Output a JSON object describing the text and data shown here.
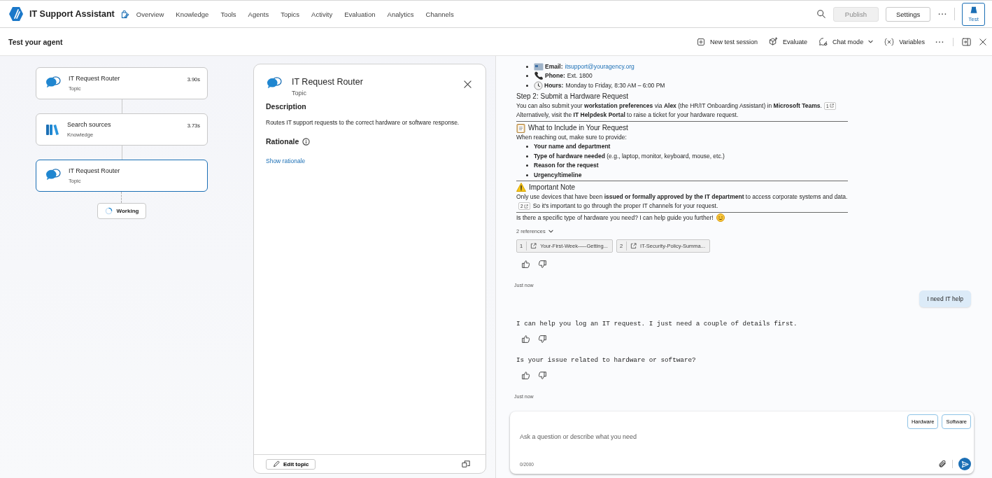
{
  "app": {
    "title": "IT Support Assistant",
    "nav": [
      "Overview",
      "Knowledge",
      "Tools",
      "Agents",
      "Topics",
      "Activity",
      "Evaluation",
      "Analytics",
      "Channels"
    ],
    "publish": {
      "label": "Publish",
      "disabled": true
    },
    "settings": {
      "label": "Settings"
    },
    "test": {
      "label": "Test",
      "selected": true
    }
  },
  "subheader": {
    "title": "Test your agent",
    "actions": [
      {
        "label": "New test session",
        "kind": "new"
      },
      {
        "label": "Evaluate",
        "kind": "evaluate"
      },
      {
        "label": "Chat mode",
        "kind": "chatmode"
      },
      {
        "label": "Variables",
        "kind": "variables"
      }
    ]
  },
  "flow": {
    "nodes": [
      {
        "title": "IT Request Router",
        "type": "Topic",
        "time": "3.90s",
        "kind": "topic",
        "selected": false
      },
      {
        "title": "Search sources",
        "type": "Knowledge",
        "time": "3.73s",
        "kind": "knowledge",
        "selected": false
      },
      {
        "title": "IT Request Router",
        "type": "Topic",
        "kind": "topic",
        "selected": true
      }
    ],
    "working": "Working"
  },
  "detail": {
    "title": "IT Request Router",
    "type": "Topic",
    "description_heading": "Description",
    "description": "Routes IT support requests to the correct hardware or software response.",
    "rationale_heading": "Rationale",
    "rationale_link": "Show rationale",
    "edit_button": "Edit topic"
  },
  "chat": {
    "messages": [
      {
        "kind": "rich",
        "blocks": [
          {
            "kind": "contacts",
            "items": [
              {
                "kind": "email",
                "label": "Email:",
                "value": "itsupport@youragency.org"
              },
              {
                "kind": "phone",
                "label": "Phone:",
                "value": "Ext. 1800"
              },
              {
                "kind": "clock",
                "label": "Hours:",
                "value": "Monday to Friday, 8:30 AM – 6:00 PM"
              }
            ]
          },
          {
            "kind": "heading",
            "text": "Step 2: Submit a Hardware Request"
          },
          {
            "kind": "para",
            "text": "You can also submit your **workstation preferences** via **Alex** (the HR/IT Onboarding Assistant) in **Microsoft Teams**.",
            "citation": "1"
          },
          {
            "kind": "para",
            "text": "Alternatively, visit the **IT Helpdesk Portal** to raise a ticket for your hardware request."
          },
          {
            "kind": "rule"
          },
          {
            "kind": "checklist",
            "text": "What to Include in Your Request"
          },
          {
            "kind": "para",
            "text": "When reaching out, make sure to provide:"
          },
          {
            "kind": "bullets",
            "items": [
              {
                "text": "**Your name and department**"
              },
              {
                "text": "**Type of hardware needed** (e.g., laptop, monitor, keyboard, mouse, etc.)"
              },
              {
                "text": "**Reason for the request**"
              },
              {
                "text": "**Urgency/timeline**"
              }
            ]
          },
          {
            "kind": "rule"
          },
          {
            "kind": "warning",
            "text": "Important Note"
          },
          {
            "kind": "para",
            "text": "Only use devices that have been **issued or formally approved by the IT department** to access corporate systems and data.",
            "citation": "2",
            "tail": "So it's important to go through the proper IT channels for your request."
          },
          {
            "kind": "rule"
          },
          {
            "kind": "closing",
            "text": "Is there a specific type of hardware you need? I can help guide you further!"
          }
        ],
        "references": {
          "label": "2 references",
          "expanded": true,
          "items": [
            {
              "number": "1",
              "title": "Your-First-Week-—-Getting..."
            },
            {
              "number": "2",
              "title": "IT-Security-Policy-Summa..."
            }
          ]
        }
      },
      {
        "kind": "timestamp",
        "text": "Just now"
      },
      {
        "kind": "user",
        "text": "I need IT help"
      },
      {
        "kind": "bot",
        "text": "I can help you log an IT request. I just need a couple of details first."
      },
      {
        "kind": "bot",
        "text": "Is your issue related to hardware or software?"
      },
      {
        "kind": "timestamp",
        "text": "Just now"
      }
    ],
    "input": {
      "suggestions": [
        "Hardware",
        "Software"
      ],
      "placeholder": "Ask a question or describe what you need",
      "counter": "0/2000"
    }
  }
}
